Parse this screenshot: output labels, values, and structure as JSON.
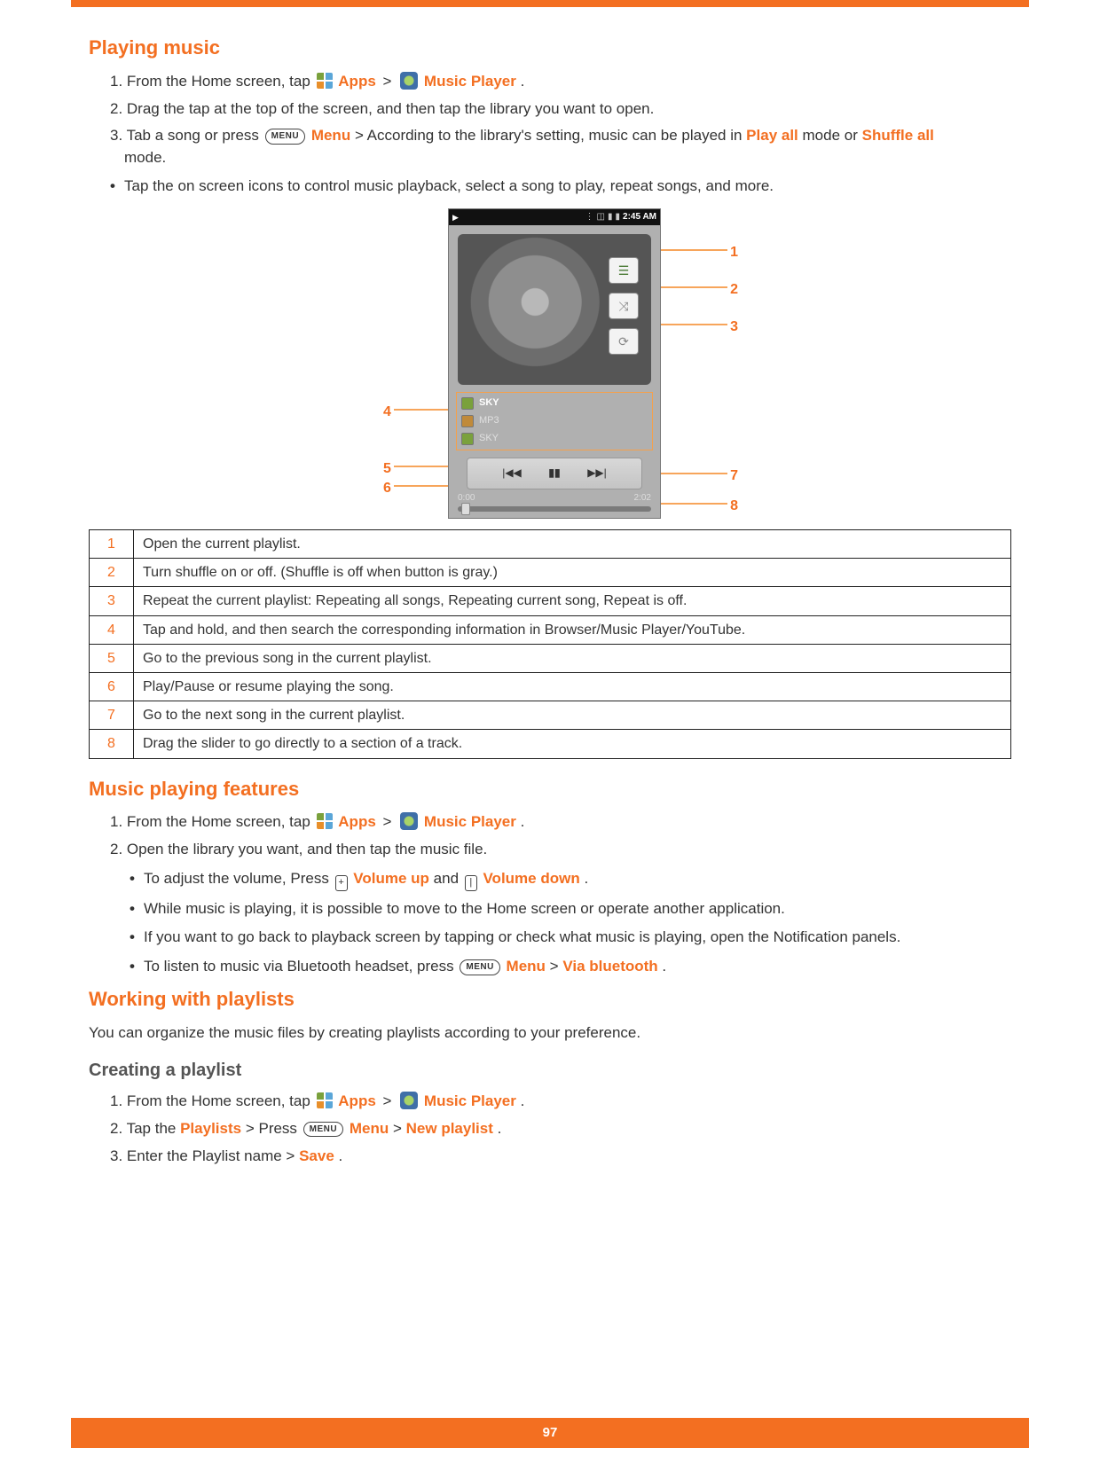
{
  "section1": {
    "title": "Playing music",
    "step1_pre": "1. From the Home screen, tap ",
    "apps": "Apps",
    "gt": ">",
    "mplayer": "Music Player",
    "period": ".",
    "step2": "2. Drag the tap at the top of the screen, and then tap the library you want to open.",
    "step3_pre": "3. Tab a song or press ",
    "menu_key": "MENU",
    "menu_word": "Menu",
    "step3_mid": " > According to the library's setting, music can be played in ",
    "playall": "Play all",
    "step3_mid2": " mode or ",
    "shuffleall": "Shuffle all",
    "step3_end": " mode.",
    "bullet1": "Tap the on screen icons to control music playback, select a song to play, repeat songs, and more."
  },
  "phonemock": {
    "time": "2:45 AM",
    "row1": "SKY",
    "row2": "MP3",
    "row3": "SKY",
    "t0": "0:00",
    "t1": "2:02"
  },
  "callouts": {
    "c1": "1",
    "c2": "2",
    "c3": "3",
    "c4": "4",
    "c5": "5",
    "c6": "6",
    "c7": "7",
    "c8": "8"
  },
  "legend": [
    {
      "n": "1",
      "t": "Open the current playlist."
    },
    {
      "n": "2",
      "t": "Turn shuffle on or off. (Shuffle is off when button is gray.)"
    },
    {
      "n": "3",
      "t": "Repeat the current playlist: Repeating all songs, Repeating current song, Repeat is off."
    },
    {
      "n": "4",
      "t": "Tap and hold, and then search the corresponding information in Browser/Music Player/YouTube."
    },
    {
      "n": "5",
      "t": "Go to the previous song in the current playlist."
    },
    {
      "n": "6",
      "t": "Play/Pause or resume playing the song."
    },
    {
      "n": "7",
      "t": "Go to the next song in the current playlist."
    },
    {
      "n": "8",
      "t": "Drag the slider to go directly to a section of a track."
    }
  ],
  "section2": {
    "title": "Music playing features",
    "step1_pre": "1. From the Home screen, tap ",
    "step2": "2. Open the library you want, and then tap the music file.",
    "b1_pre": "To adjust the volume, Press ",
    "vup_key": "+",
    "vup": "Volume up",
    "b1_and": " and ",
    "vdn_key": "|",
    "vdn": "Volume down",
    "b2": "While music is playing, it is possible to move to the Home screen or operate another application.",
    "b3": "If you want to go back to playback screen by tapping or check what music is playing, open the Notification panels.",
    "b4_pre": "To listen to music via Bluetooth headset, press ",
    "b4_mid": " > ",
    "viabt": "Via bluetooth"
  },
  "section3": {
    "title": "Working with playlists",
    "intro": "You can organize the music files by creating playlists according to your preference.",
    "subhead": "Creating a playlist",
    "step1_pre": "1. From the Home screen, tap ",
    "step2_pre": "2. Tap the ",
    "playlists": "Playlists",
    "step2_mid": " > Press ",
    "step2_mid2": " > ",
    "newpl": "New playlist",
    "step3_pre": "3. Enter the Playlist name > ",
    "save": "Save"
  },
  "footer": {
    "page": "97"
  }
}
